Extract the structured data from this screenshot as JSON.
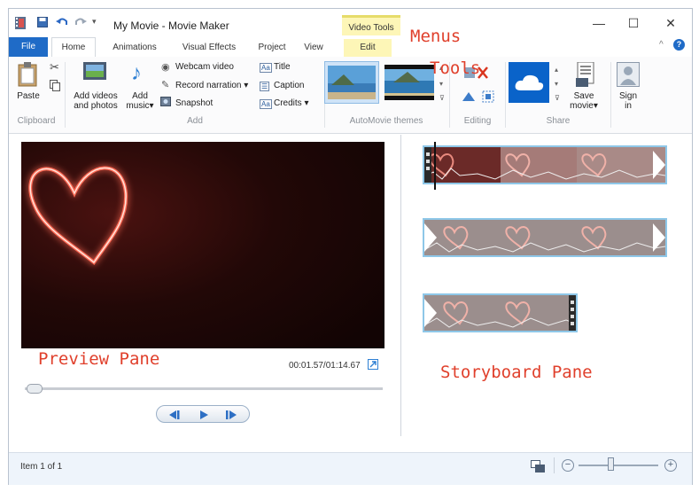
{
  "window": {
    "title": "My Movie - Movie Maker",
    "context_tab_group": "Video Tools",
    "minimize_glyph": "—",
    "maximize_glyph": "☐",
    "close_glyph": "✕"
  },
  "tabs": [
    {
      "label": "File"
    },
    {
      "label": "Home"
    },
    {
      "label": "Animations"
    },
    {
      "label": "Visual Effects"
    },
    {
      "label": "Project"
    },
    {
      "label": "View"
    },
    {
      "label": "Edit"
    }
  ],
  "ribbon": {
    "clipboard": {
      "group_label": "Clipboard",
      "paste_label": "Paste"
    },
    "add": {
      "group_label": "Add",
      "add_videos_label_1": "Add videos",
      "add_videos_label_2": "and photos",
      "add_music_label_1": "Add",
      "add_music_label_2": "music",
      "webcam_video": "Webcam video",
      "record_narration": "Record narration",
      "snapshot": "Snapshot",
      "title": "Title",
      "caption": "Caption",
      "credits": "Credits"
    },
    "themes": {
      "group_label": "AutoMovie themes"
    },
    "editing": {
      "group_label": "Editing"
    },
    "share": {
      "group_label": "Share",
      "save_movie_1": "Save",
      "save_movie_2": "movie",
      "sign_in_1": "Sign",
      "sign_in_2": "in"
    }
  },
  "annotations": {
    "menus": "Menus",
    "tools": "Tools",
    "preview_pane": "Preview Pane",
    "storyboard_pane": "Storyboard Pane"
  },
  "preview": {
    "time_readout": "00:01.57/01:14.67"
  },
  "status": {
    "item_text": "Item 1 of 1"
  },
  "colors": {
    "file_tab": "#1f6bc7",
    "annotation": "#e0402c",
    "storyboard_border": "#8ec7e8",
    "context_tab": "#fdf6b7"
  }
}
